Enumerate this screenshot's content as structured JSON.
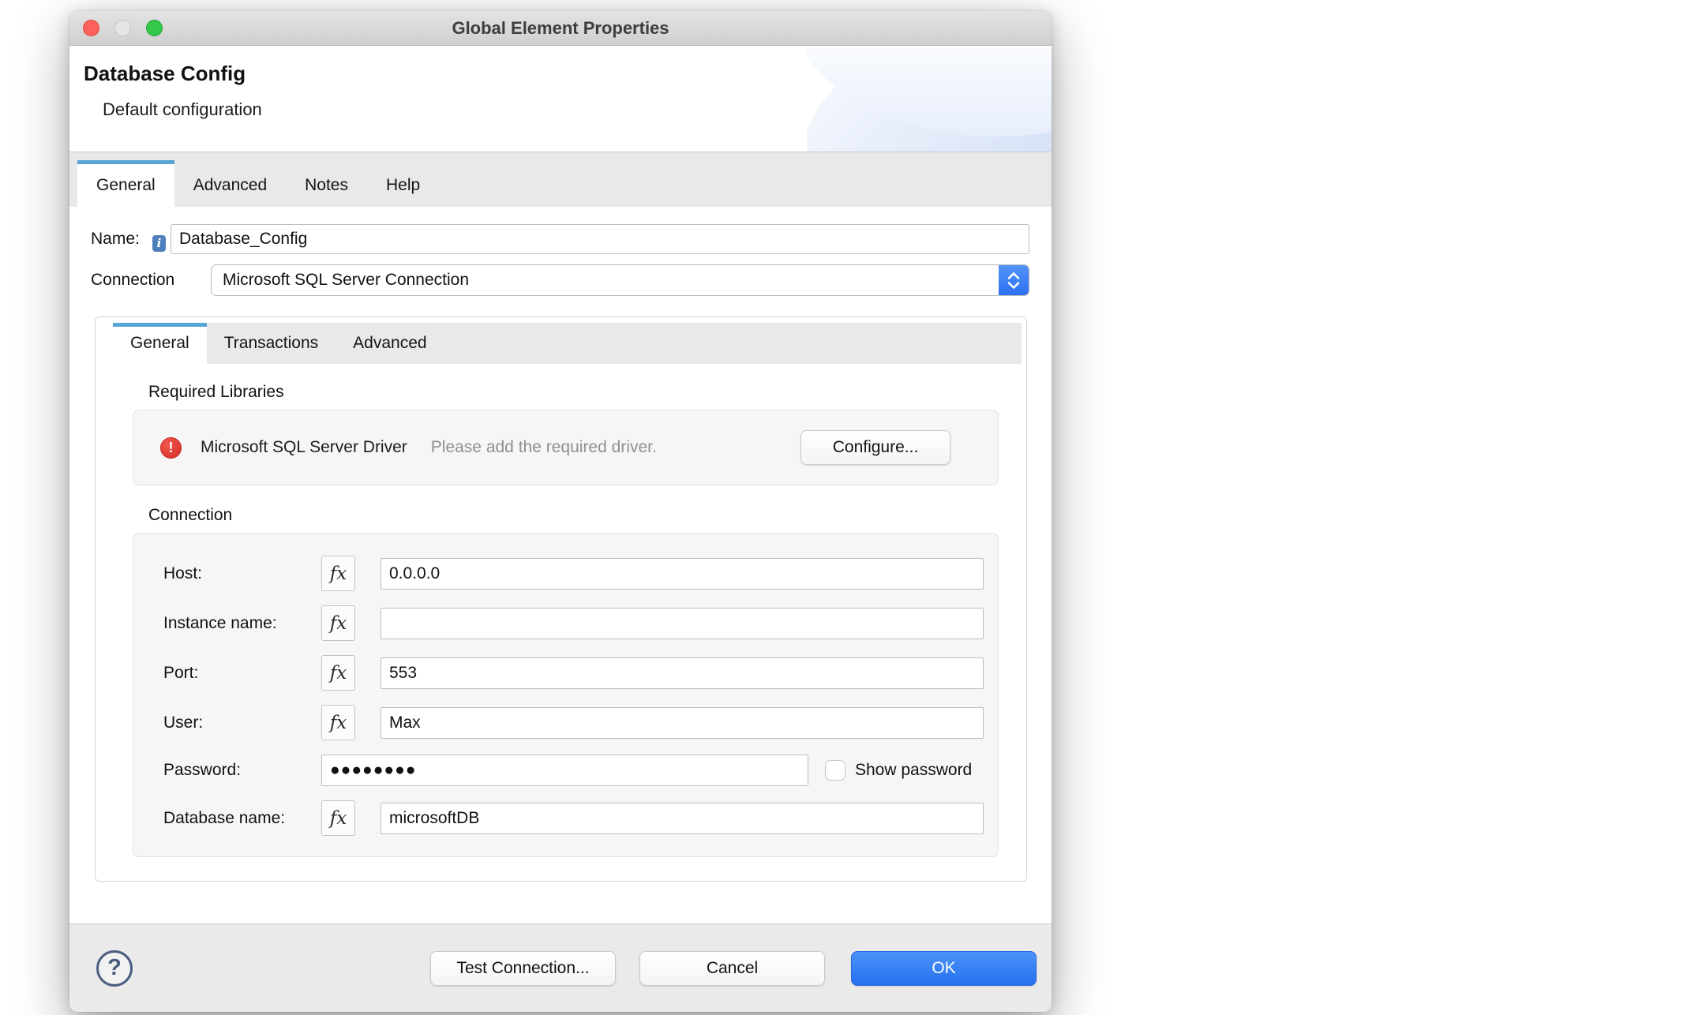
{
  "window": {
    "title": "Global Element Properties"
  },
  "header": {
    "title": "Database Config",
    "subtitle": "Default configuration"
  },
  "outer_tabs": [
    {
      "label": "General",
      "active": true
    },
    {
      "label": "Advanced",
      "active": false
    },
    {
      "label": "Notes",
      "active": false
    },
    {
      "label": "Help",
      "active": false
    }
  ],
  "name_field": {
    "label": "Name:",
    "value": "Database_Config",
    "info_icon": "i"
  },
  "connection_field": {
    "label": "Connection",
    "value": "Microsoft SQL Server Connection"
  },
  "inner_tabs": [
    {
      "label": "General",
      "active": true
    },
    {
      "label": "Transactions",
      "active": false
    },
    {
      "label": "Advanced",
      "active": false
    }
  ],
  "required_libraries": {
    "section_label": "Required Libraries",
    "error_icon": "!",
    "driver_name": "Microsoft SQL Server Driver",
    "message": "Please add the required driver.",
    "configure_label": "Configure..."
  },
  "connection_section": {
    "section_label": "Connection",
    "fx_glyph": "fx",
    "fields": [
      {
        "label": "Host:",
        "value": "0.0.0.0",
        "fx": true
      },
      {
        "label": "Instance name:",
        "value": "",
        "fx": true
      },
      {
        "label": "Port:",
        "value": "553",
        "fx": true
      },
      {
        "label": "User:",
        "value": "Max",
        "fx": true
      },
      {
        "label": "Password:",
        "value": "●●●●●●●●",
        "fx": false,
        "password": true,
        "checkbox_label": "Show password",
        "checkbox_checked": false
      },
      {
        "label": "Database name:",
        "value": "microsoftDB",
        "fx": true
      }
    ]
  },
  "footer": {
    "help_label": "?",
    "test_label": "Test Connection...",
    "cancel_label": "Cancel",
    "ok_label": "OK"
  },
  "colors": {
    "accent_blue": "#2f74f2",
    "tab_accent": "#55a5d6",
    "error_red": "#dc3a30",
    "traffic_red": "#fc615c",
    "traffic_green": "#34c749"
  }
}
